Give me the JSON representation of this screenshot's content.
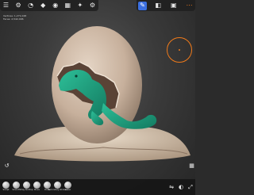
{
  "info": {
    "line1": "Vertices: 1,271,048",
    "line2": "Faces: 2,542,096"
  },
  "toolbar_left": {
    "icons": [
      "layers-icon",
      "settings-icon",
      "history-icon",
      "object-icon",
      "camera-icon",
      "grid-icon",
      "tools-icon",
      "gear-icon"
    ]
  },
  "toolbar_right": {
    "icons": [
      "brush-icon",
      "eraser-icon",
      "cube-icon",
      "more-icon"
    ]
  },
  "bottombar": {
    "tools": [
      {
        "name": "Sculpt",
        "icon": "sculpt-icon"
      },
      {
        "name": "Smooth",
        "icon": "smooth-icon"
      },
      {
        "name": "Clay buildup",
        "icon": "clay-icon"
      },
      {
        "name": "Move",
        "icon": "move-icon"
      },
      {
        "name": "Draw",
        "icon": "draw-icon"
      },
      {
        "name": "Secondary strokes",
        "icon": "secondary-icon"
      },
      {
        "name": "Lasso",
        "icon": "lasso-icon"
      }
    ]
  },
  "colors": {
    "accent": "#f07a1a",
    "active": "#3b6fe0",
    "dino": "#1f9e7e",
    "egg": "#cbb6a3"
  }
}
